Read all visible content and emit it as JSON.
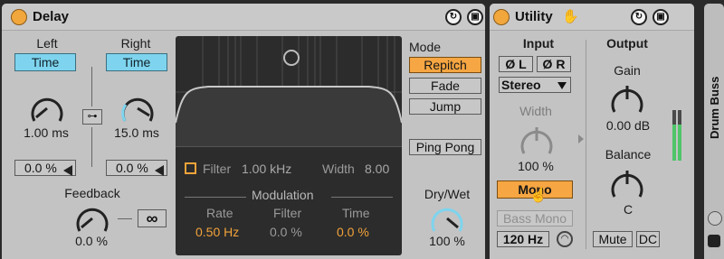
{
  "delay": {
    "title": "Delay",
    "left": {
      "label": "Left",
      "mode": "Time",
      "value": "1.00 ms",
      "offset": "0.0 %"
    },
    "right": {
      "label": "Right",
      "mode": "Time",
      "value": "15.0 ms",
      "offset": "0.0 %"
    },
    "feedback": {
      "label": "Feedback",
      "value": "0.0 %"
    },
    "filter": {
      "label": "Filter",
      "freq": "1.00 kHz",
      "width_label": "Width",
      "width": "8.00"
    },
    "modulation": {
      "title": "Modulation",
      "rate_label": "Rate",
      "rate": "0.50 Hz",
      "filter_label": "Filter",
      "filter": "0.0 %",
      "time_label": "Time",
      "time": "0.0 %"
    },
    "mode": {
      "label": "Mode",
      "repitch": "Repitch",
      "fade": "Fade",
      "jump": "Jump",
      "selected": "Repitch"
    },
    "ping_pong": "Ping Pong",
    "drywet": {
      "label": "Dry/Wet",
      "value": "100 %"
    }
  },
  "utility": {
    "title": "Utility",
    "input_label": "Input",
    "output_label": "Output",
    "phase_l": "Ø L",
    "phase_r": "Ø R",
    "channel_mode": "Stereo",
    "width_label": "Width",
    "width_value": "100 %",
    "mono": "Mono",
    "bass_mono": "Bass Mono",
    "bass_freq": "120 Hz",
    "gain_label": "Gain",
    "gain_value": "0.00 dB",
    "balance_label": "Balance",
    "balance_value": "C",
    "mute": "Mute",
    "dc": "DC"
  },
  "next_device": {
    "title": "Drum Buss"
  },
  "colors": {
    "accent_orange": "#f6a642",
    "accent_blue": "#7ed4ee",
    "display_bg": "#2c2c2c",
    "mod_orange": "#f2a33a"
  }
}
